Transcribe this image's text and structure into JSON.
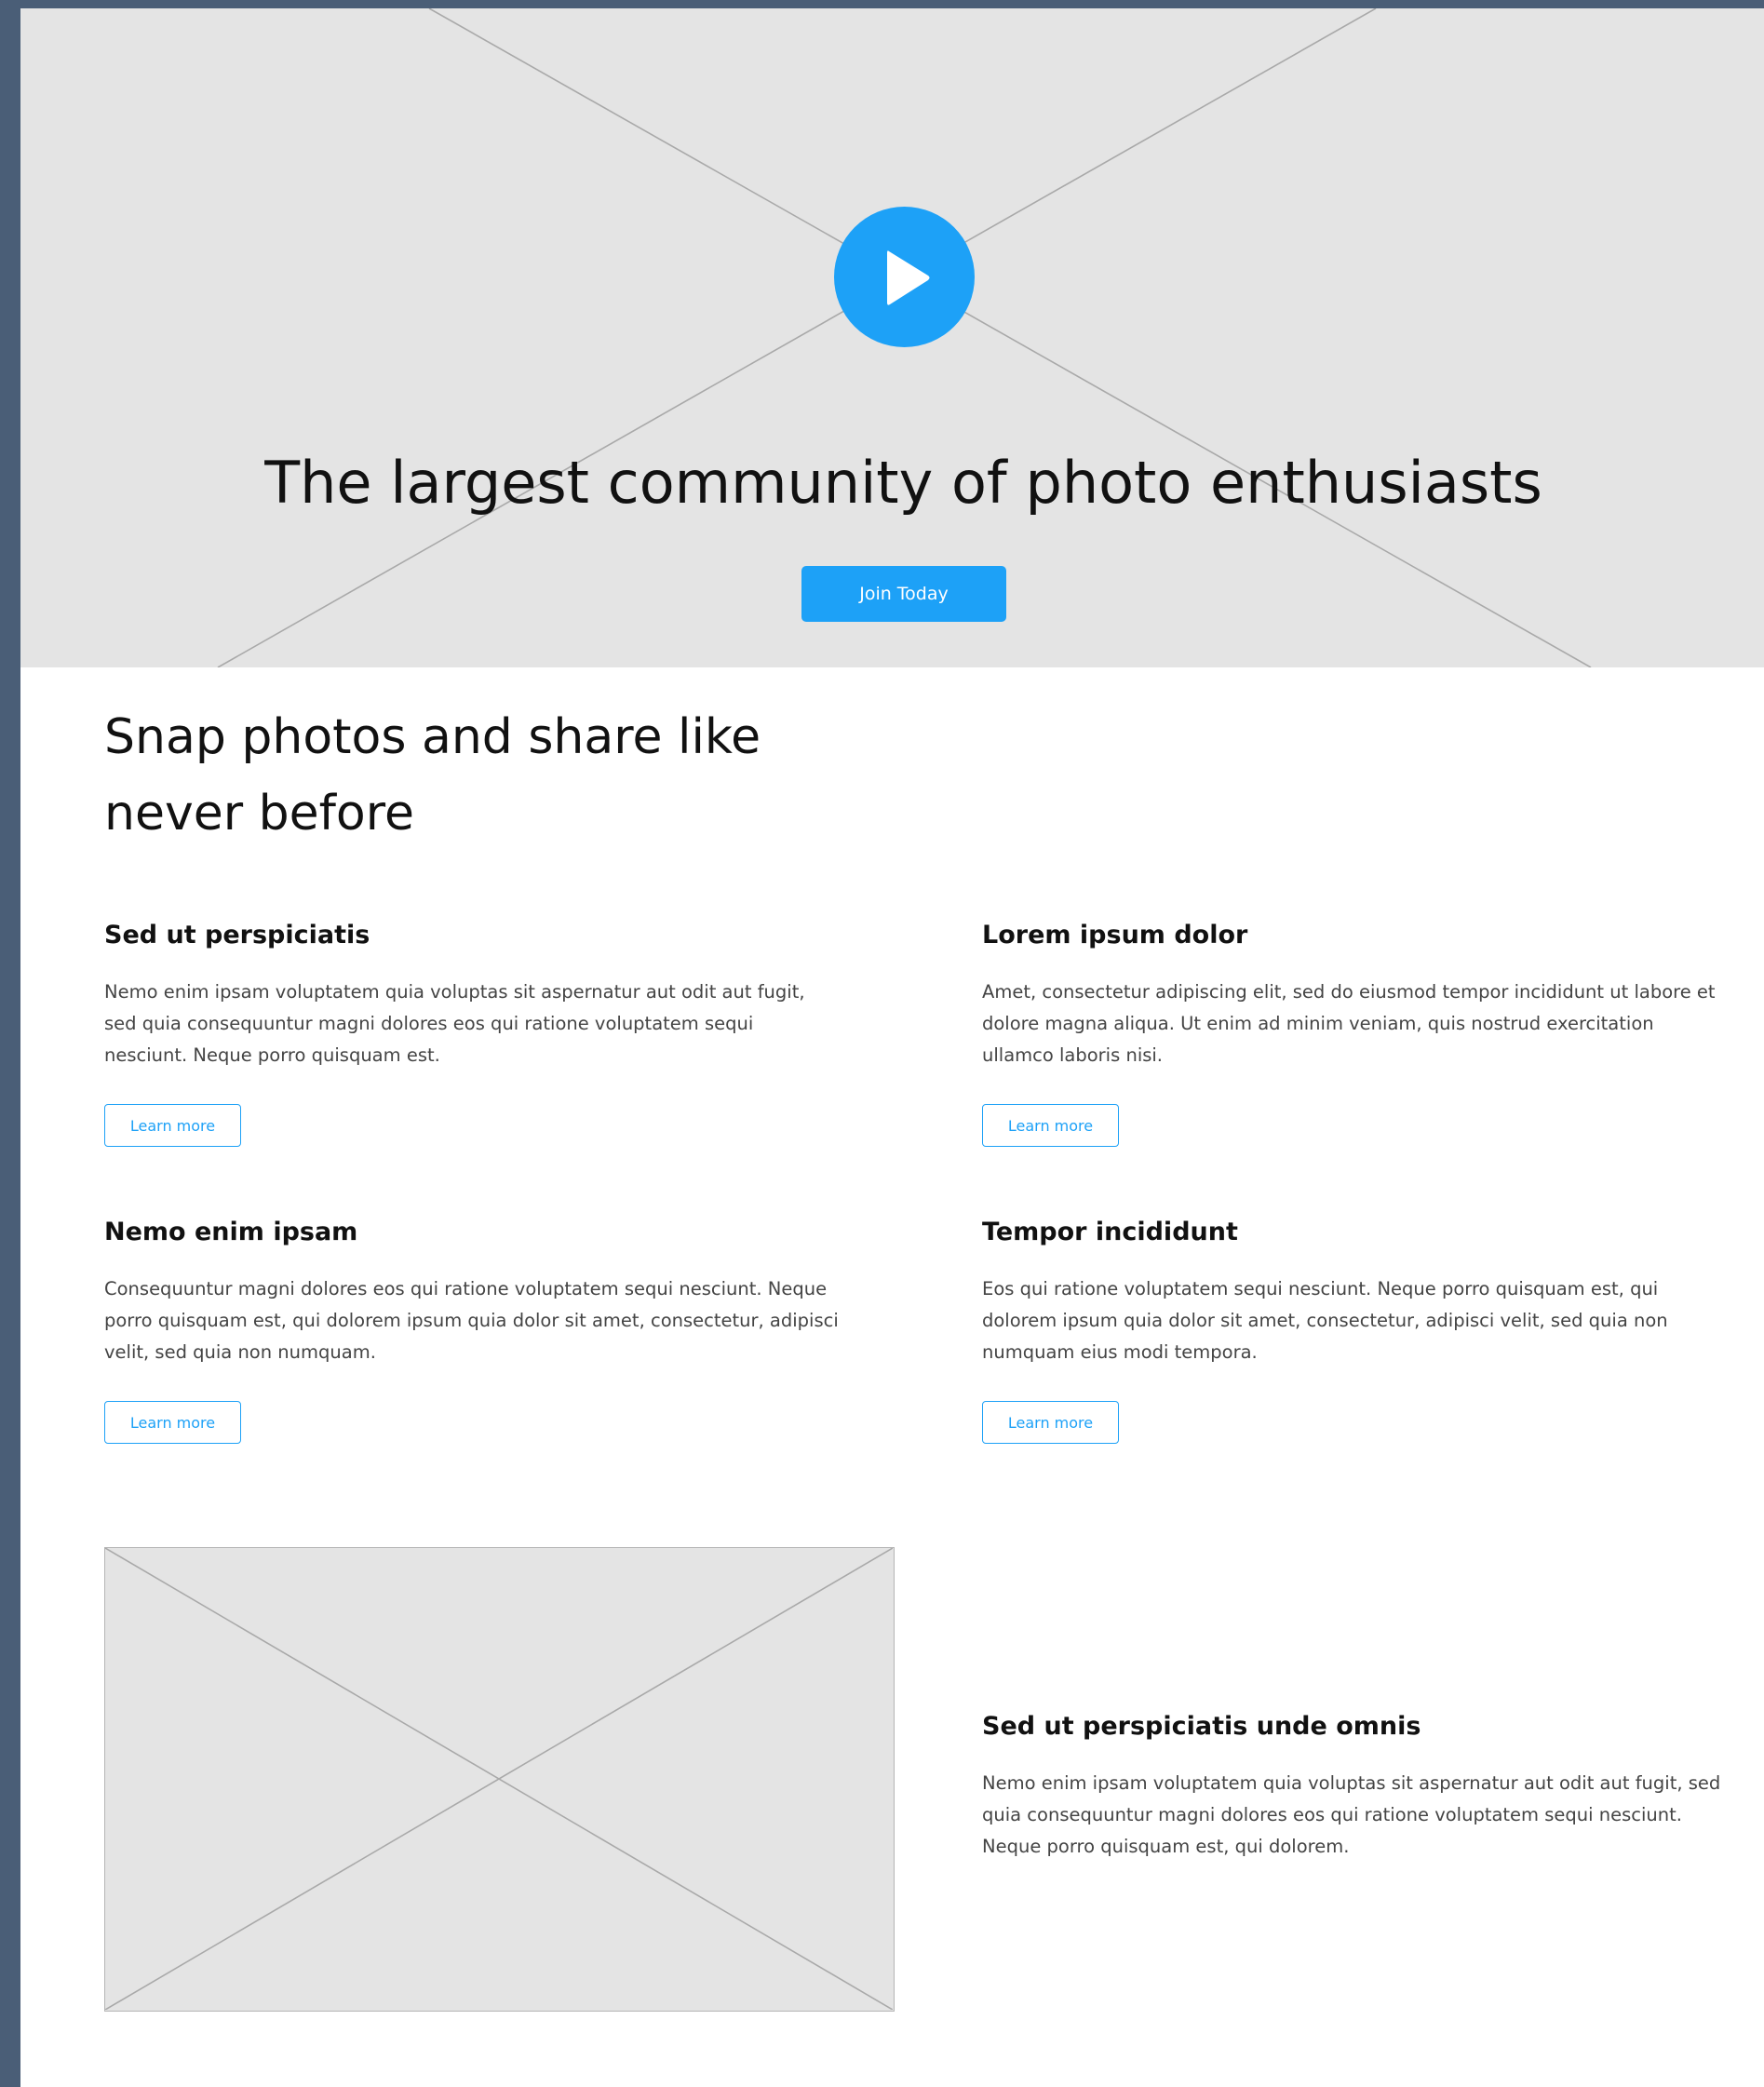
{
  "colors": {
    "accent": "#1da1f7",
    "placeholder_bg": "#e4e4e4",
    "frame_bg": "#4a5e77",
    "heading": "#111111",
    "body_text": "#444444"
  },
  "hero": {
    "play_icon": "play-icon",
    "title": "The largest community of photo enthusiasts",
    "cta_label": "Join Today"
  },
  "intro": {
    "title_line1": "Snap photos and share like",
    "title_line2": "never before"
  },
  "features": [
    {
      "title": "Sed ut perspiciatis",
      "body": "Nemo enim ipsam voluptatem quia voluptas sit aspernatur aut odit aut fugit, sed quia consequuntur magni dolores eos qui ratione voluptatem sequi nesciunt. Neque porro quisquam est.",
      "button_label": "Learn more"
    },
    {
      "title": "Lorem ipsum dolor",
      "body": "Amet, consectetur adipiscing elit, sed do eiusmod tempor incididunt ut labore et dolore magna aliqua. Ut enim ad minim veniam, quis nostrud exercitation ullamco laboris nisi.",
      "button_label": "Learn more"
    },
    {
      "title": "Nemo enim ipsam",
      "body": "Consequuntur magni dolores eos qui ratione voluptatem sequi nesciunt. Neque porro quisquam est, qui dolorem ipsum quia dolor sit amet, consectetur, adipisci velit, sed quia non numquam.",
      "button_label": "Learn more"
    },
    {
      "title": "Tempor incididunt",
      "body": "Eos qui ratione voluptatem sequi nesciunt. Neque porro quisquam est, qui dolorem ipsum quia dolor sit amet, consectetur, adipisci velit, sed quia non numquam eius modi tempora.",
      "button_label": "Learn more"
    }
  ],
  "media_section": {
    "image_icon": "image-placeholder-icon",
    "title": "Sed ut perspiciatis unde omnis",
    "body": "Nemo enim ipsam voluptatem quia voluptas sit aspernatur aut odit aut fugit, sed quia consequuntur magni dolores eos qui ratione voluptatem sequi nesciunt. Neque porro quisquam est, qui dolorem."
  }
}
